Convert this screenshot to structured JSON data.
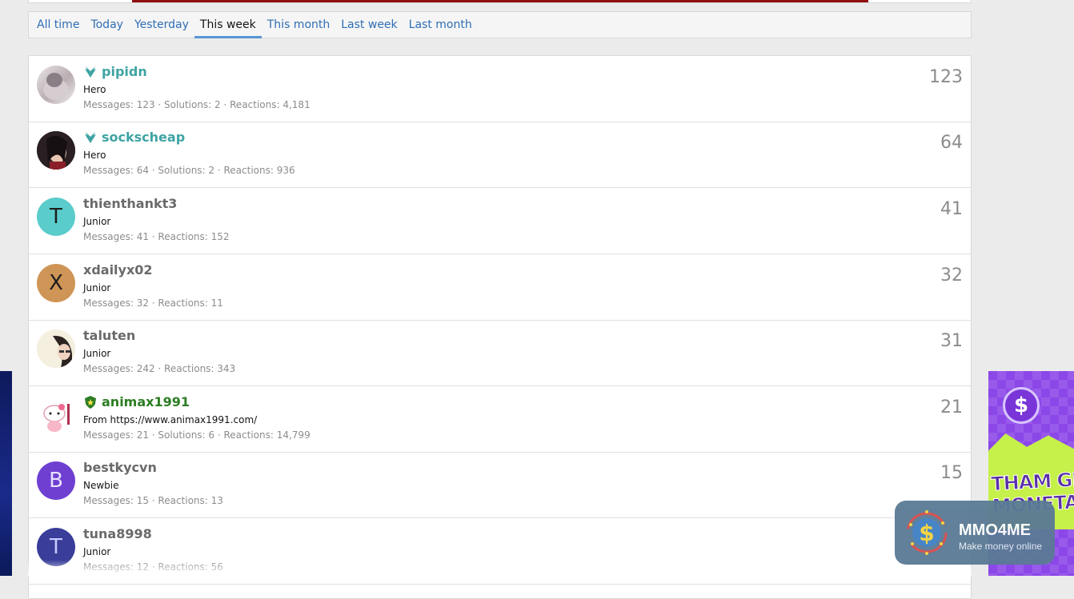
{
  "tabs": [
    {
      "label": "All time",
      "active": false
    },
    {
      "label": "Today",
      "active": false
    },
    {
      "label": "Yesterday",
      "active": false
    },
    {
      "label": "This week",
      "active": true
    },
    {
      "label": "This month",
      "active": false
    },
    {
      "label": "Last week",
      "active": false
    },
    {
      "label": "Last month",
      "active": false
    }
  ],
  "members": [
    {
      "username": "pipidn",
      "title": "Hero",
      "stats": "Messages: 123 · Solutions: 2 · Reactions: 4,181",
      "count": "123",
      "name_color": "teal",
      "badge": "wings-icon",
      "avatar": "photo"
    },
    {
      "username": "sockscheap",
      "title": "Hero",
      "stats": "Messages: 64 · Solutions: 2 · Reactions: 936",
      "count": "64",
      "name_color": "teal",
      "badge": "wings-icon",
      "avatar": "photo"
    },
    {
      "username": "thienthankt3",
      "title": "Junior",
      "stats": "Messages: 41 · Reactions: 152",
      "count": "41",
      "name_color": "gray",
      "avatar_letter": "T",
      "avatar_color": "#5bcccc"
    },
    {
      "username": "xdailyx02",
      "title": "Junior",
      "stats": "Messages: 32 · Reactions: 11",
      "count": "32",
      "name_color": "gray",
      "avatar_letter": "X",
      "avatar_color": "#cf9556"
    },
    {
      "username": "taluten",
      "title": "Junior",
      "stats": "Messages: 242 · Reactions: 343",
      "count": "31",
      "name_color": "gray",
      "avatar": "photo"
    },
    {
      "username": "animax1991",
      "title": "From https://www.animax1991.com/",
      "stats": "Messages: 21 · Solutions: 6 · Reactions: 14,799",
      "count": "21",
      "name_color": "green",
      "badge": "shield-star-icon",
      "avatar": "photo"
    },
    {
      "username": "bestkycvn",
      "title": "Newbie",
      "stats": "Messages: 15 · Reactions: 13",
      "count": "15",
      "name_color": "gray",
      "avatar_letter": "B",
      "avatar_color": "#6f3fd1"
    },
    {
      "username": "tuna8998",
      "title": "Junior",
      "stats": "Messages: 12 · Reactions: 56",
      "count": "",
      "name_color": "gray",
      "avatar_letter": "T",
      "avatar_color": "#3a3d99"
    }
  ],
  "ad": {
    "text": "THAM GIA MONETAG"
  },
  "logo": {
    "name": "MMO4ME",
    "tagline": "Make money online"
  },
  "colors": {
    "link": "#2f6eb4",
    "tab_underline": "#5897d3",
    "teal_name": "#3fa3a3",
    "green_name": "#2c7d23",
    "top_red": "#8f0f0f"
  }
}
